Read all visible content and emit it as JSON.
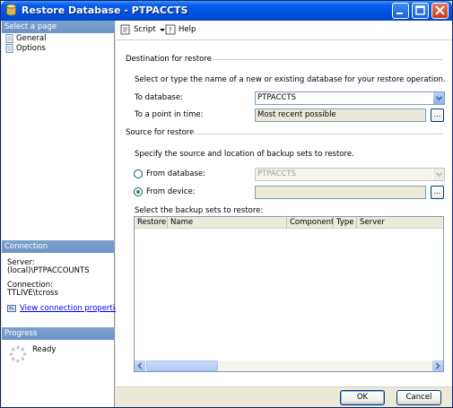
{
  "window": {
    "title": "Restore Database - PTPACCTS"
  },
  "left": {
    "select_page_header": "Select a page",
    "pages": [
      {
        "label": "General"
      },
      {
        "label": "Options"
      }
    ],
    "connection_header": "Connection",
    "server_label": "Server:",
    "server_value": "(local)\\PTPACCOUNTS",
    "connection_label": "Connection:",
    "connection_value": "TTLIVE\\tcross",
    "view_connection_link": "View connection properties",
    "progress_header": "Progress",
    "progress_status": "Ready"
  },
  "toolbar": {
    "script_label": "Script",
    "help_label": "Help"
  },
  "destination": {
    "group_label": "Destination for restore",
    "instruction": "Select or type the name of a new or existing database for your restore operation.",
    "to_database_label": "To database:",
    "to_database_value": "PTPACCTS",
    "point_in_time_label": "To a point in time:",
    "point_in_time_value": "Most recent possible",
    "ellipsis": "..."
  },
  "source": {
    "group_label": "Source for restore",
    "instruction": "Specify the source and location of backup sets to restore.",
    "from_database_label": "From database:",
    "from_database_value": "PTPACCTS",
    "from_device_label": "From device:",
    "from_device_value": "",
    "ellipsis": "...",
    "selected_option": "From device"
  },
  "backup_sets": {
    "label": "Select the backup sets to restore:",
    "columns": [
      "Restore",
      "Name",
      "Component",
      "Type",
      "Server"
    ],
    "rows": []
  },
  "buttons": {
    "ok": "OK",
    "cancel": "Cancel"
  },
  "colors": {
    "title_blue": "#0053E1",
    "pane_header": "#7DA2CE",
    "link": "#0000FF",
    "radio_checked": "#21A121"
  }
}
